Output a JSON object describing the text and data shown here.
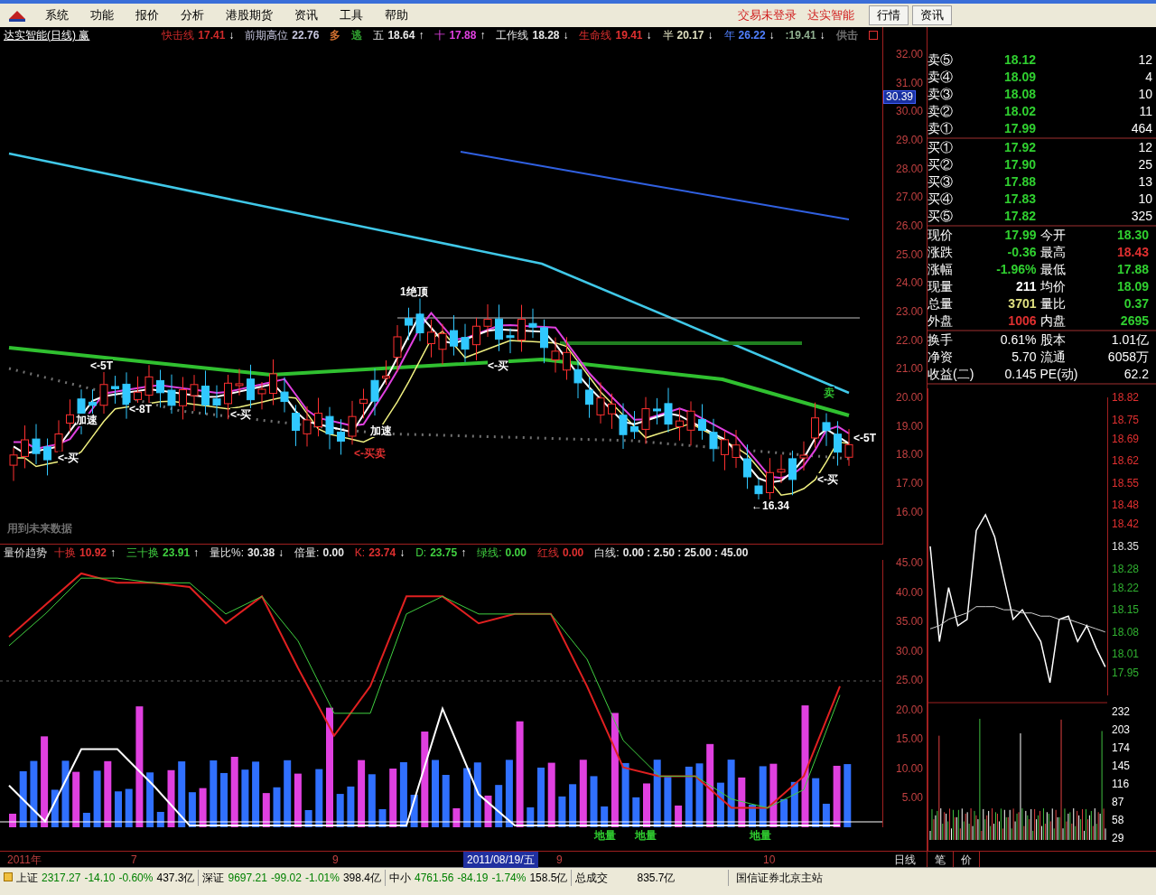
{
  "menu": {
    "items": [
      "系统",
      "功能",
      "报价",
      "分析",
      "港股期货",
      "资讯",
      "工具",
      "帮助"
    ],
    "status": [
      "交易未登录",
      "达实智能"
    ],
    "buttons": [
      "行情",
      "资讯"
    ]
  },
  "price_chart": {
    "title": "达实智能(日线) 赢",
    "indicators": [
      {
        "label": "快击线",
        "value": "17.41",
        "arrow": "↓",
        "color": "#d02a2a"
      },
      {
        "label": "前期高位",
        "value": "22.76",
        "color": "#c8c8e0"
      },
      {
        "label": "多",
        "color": "#d07030"
      },
      {
        "label": "逃",
        "color": "#30a030"
      },
      {
        "label": "五",
        "value": "18.64",
        "arrow": "↑",
        "color": "#e8e8e8"
      },
      {
        "label": "十",
        "value": "17.88",
        "arrow": "↑",
        "color": "#e040e0"
      },
      {
        "label": "工作线",
        "value": "18.28",
        "arrow": "↓",
        "color": "#e8e8e8"
      },
      {
        "label": "生命线",
        "value": "19.41",
        "arrow": "↓",
        "color": "#e03030"
      },
      {
        "label": "半",
        "value": "20.17",
        "arrow": "↓",
        "color": "#e0e0c0"
      },
      {
        "label": "年",
        "value": "26.22",
        "arrow": "↓",
        "color": "#5080ff"
      },
      {
        "value": ":19.41",
        "arrow": "↓",
        "color": "#90b090"
      },
      {
        "label": "供击",
        "color": "#707070"
      }
    ],
    "y_ticks": [
      "32.00",
      "31.00",
      "30.00",
      "29.00",
      "28.00",
      "27.00",
      "26.00",
      "25.00",
      "24.00",
      "23.00",
      "22.00",
      "21.00",
      "20.00",
      "19.00",
      "18.00",
      "17.00",
      "16.00"
    ],
    "current_marker": "30.39",
    "annotations": [
      {
        "text": "用到未来数据",
        "color": "#707070"
      },
      {
        "text": "1绝顶",
        "color": "#ffffff"
      },
      {
        "text": "<-5T",
        "color": "#ffffff"
      },
      {
        "text": "加速",
        "color": "#ffffff"
      },
      {
        "text": "<-8T",
        "color": "#ffffff"
      },
      {
        "text": "<-买",
        "color": "#ffffff"
      },
      {
        "text": "<-买",
        "color": "#ffffff"
      },
      {
        "text": "加速",
        "color": "#ffffff"
      },
      {
        "text": "<-买卖",
        "color": "#e03030"
      },
      {
        "text": "<-买",
        "color": "#ffffff"
      },
      {
        "text": "←16.34",
        "color": "#ffffff"
      },
      {
        "text": "卖",
        "color": "#30c030"
      },
      {
        "text": "<-5T",
        "color": "#ffffff"
      },
      {
        "text": "<-买",
        "color": "#ffffff"
      }
    ]
  },
  "volume_indicator": {
    "title": "量价趋势",
    "indicators": [
      {
        "label": "十换",
        "value": "10.92",
        "arrow": "↑",
        "color": "#e03030"
      },
      {
        "label": "三十换",
        "value": "23.91",
        "arrow": "↑",
        "color": "#40d040"
      },
      {
        "label": "量比%:",
        "value": "30.38",
        "arrow": "↓",
        "color": "#e8e8e8"
      },
      {
        "label": "倍量:",
        "value": "0.00",
        "color": "#e8e8e8"
      },
      {
        "label": "K:",
        "value": "23.74",
        "arrow": "↓",
        "color": "#e03030"
      },
      {
        "label": "D:",
        "value": "23.75",
        "arrow": "↑",
        "color": "#40d040"
      },
      {
        "label": "绿线:",
        "value": "0.00",
        "color": "#40d040"
      },
      {
        "label": "红线",
        "value": "0.00",
        "color": "#e03030"
      },
      {
        "label": "白线:",
        "value": "0.00 : 2.50 : 25.00 : 45.00",
        "color": "#e8e8e8"
      }
    ],
    "annotations": [
      {
        "text": "地量",
        "color": "#30d030"
      },
      {
        "text": "地量",
        "color": "#30d030"
      },
      {
        "text": "地量",
        "color": "#30d030"
      }
    ],
    "chart_data": {
      "type": "line",
      "ylim": [
        0,
        45.5
      ],
      "yticks": [
        {
          "value": 45,
          "label": "45.00"
        },
        {
          "value": 40,
          "label": "40.00"
        },
        {
          "value": 35,
          "label": "35.00"
        },
        {
          "value": 30,
          "label": "30.00"
        },
        {
          "value": 25,
          "label": "25.00"
        },
        {
          "value": 20,
          "label": "20.00"
        },
        {
          "value": 15,
          "label": "15.00"
        },
        {
          "value": 10,
          "label": "10.00"
        },
        {
          "value": 5,
          "label": "5.00"
        }
      ],
      "series": [
        {
          "color": "#e02020",
          "values": [
            32.4,
            37.8,
            43.2,
            41.6,
            41.6,
            40.9,
            34.7,
            39.3,
            27.1,
            15.6,
            24,
            39.3,
            39.3,
            34.7,
            36.3,
            36.3,
            24,
            10.2,
            8.7,
            8.7,
            3.3,
            3.3,
            8.7,
            24
          ]
        },
        {
          "color": "#40d040",
          "values": [
            30.9,
            36.3,
            42.4,
            42.4,
            41.6,
            41.6,
            36.3,
            39.3,
            31.7,
            19.4,
            19.4,
            36.3,
            39.3,
            36.3,
            36.3,
            36.3,
            28.6,
            14.8,
            8.7,
            8.7,
            4.8,
            3.3,
            6.4,
            22.5
          ]
        },
        {
          "color": "#ffffff",
          "values": [
            7.1,
            1,
            13.3,
            13.3,
            7.1,
            0.3,
            0.3,
            0.3,
            0.3,
            0.3,
            0.3,
            0.3,
            20.2,
            5.6,
            0.3,
            0.3,
            0.3,
            0.3,
            0.3,
            0.3,
            0.3,
            0.3,
            0.3,
            0.3
          ]
        }
      ]
    }
  },
  "time_axis": {
    "labels": [
      "2011年",
      "7",
      "9",
      "2011/08/19/五",
      "9",
      "10"
    ],
    "period": "日线"
  },
  "quote": {
    "sell": [
      {
        "label": "卖⑤",
        "price": "18.12",
        "volume": "12"
      },
      {
        "label": "卖④",
        "price": "18.09",
        "volume": "4"
      },
      {
        "label": "卖③",
        "price": "18.08",
        "volume": "10"
      },
      {
        "label": "卖②",
        "price": "18.02",
        "volume": "11"
      },
      {
        "label": "卖①",
        "price": "17.99",
        "volume": "464"
      }
    ],
    "buy": [
      {
        "label": "买①",
        "price": "17.92",
        "volume": "12"
      },
      {
        "label": "买②",
        "price": "17.90",
        "volume": "25"
      },
      {
        "label": "买③",
        "price": "17.88",
        "volume": "13"
      },
      {
        "label": "买④",
        "price": "17.83",
        "volume": "10"
      },
      {
        "label": "买⑤",
        "price": "17.82",
        "volume": "325"
      }
    ],
    "stats": [
      [
        {
          "label": "现价",
          "value": "17.99",
          "color": "#30d030"
        },
        {
          "label": "今开",
          "value": "18.30",
          "color": "#30d030"
        }
      ],
      [
        {
          "label": "涨跌",
          "value": "-0.36",
          "color": "#30d030"
        },
        {
          "label": "最高",
          "value": "18.43",
          "color": "#e03030"
        }
      ],
      [
        {
          "label": "涨幅",
          "value": "-1.96%",
          "color": "#30d030"
        },
        {
          "label": "最低",
          "value": "17.88",
          "color": "#30d030"
        }
      ],
      [
        {
          "label": "现量",
          "value": "211",
          "color": "#ffffff"
        },
        {
          "label": "均价",
          "value": "18.09",
          "color": "#30d030"
        }
      ],
      [
        {
          "label": "总量",
          "value": "3701",
          "color": "#e0e080"
        },
        {
          "label": "量比",
          "value": "0.37",
          "color": "#30d030"
        }
      ],
      [
        {
          "label": "外盘",
          "value": "1006",
          "color": "#e03030"
        },
        {
          "label": "内盘",
          "value": "2695",
          "color": "#30d030"
        }
      ]
    ],
    "fundamentals": [
      [
        {
          "label": "换手",
          "value": "0.61%"
        },
        {
          "label": "股本",
          "value": "1.01亿"
        }
      ],
      [
        {
          "label": "净资",
          "value": "5.70"
        },
        {
          "label": "流通",
          "value": "6058万"
        }
      ],
      [
        {
          "label": "收益(二)",
          "value": "0.145"
        },
        {
          "label": "PE(动)",
          "value": "62.2"
        }
      ]
    ]
  },
  "intraday": {
    "chart_data": {
      "type": "line",
      "ylim": [
        17.88,
        18.82
      ],
      "yticks": [
        {
          "value": 18.82,
          "label": "18.82"
        },
        {
          "value": 18.75,
          "label": "18.75"
        },
        {
          "value": 18.69,
          "label": "18.69"
        },
        {
          "value": 18.62,
          "label": "18.62"
        },
        {
          "value": 18.55,
          "label": "18.55"
        },
        {
          "value": 18.48,
          "label": "18.48"
        },
        {
          "value": 18.42,
          "label": "18.42"
        },
        {
          "value": 18.35,
          "label": "18.35"
        },
        {
          "value": 18.28,
          "label": "18.28"
        },
        {
          "value": 18.22,
          "label": "18.22"
        },
        {
          "value": 18.15,
          "label": "18.15"
        },
        {
          "value": 18.08,
          "label": "18.08"
        },
        {
          "value": 18.01,
          "label": "18.01"
        },
        {
          "value": 17.95,
          "label": "17.95"
        }
      ],
      "series": [
        {
          "color": "#ffffff",
          "values": [
            18.35,
            18.05,
            18.22,
            18.1,
            18.12,
            18.4,
            18.45,
            18.38,
            18.25,
            18.12,
            18.15,
            18.1,
            18.05,
            17.92,
            18.12,
            18.13,
            18.05,
            18.1,
            18.03,
            17.97
          ]
        },
        {
          "color": "#d0d0d0",
          "values": [
            18.09,
            18.1,
            18.12,
            18.13,
            18.14,
            18.16,
            18.16,
            18.16,
            18.15,
            18.15,
            18.14,
            18.14,
            18.13,
            18.13,
            18.12,
            18.12,
            18.11,
            18.1,
            18.09,
            18.08
          ]
        }
      ]
    },
    "volume_ticks": [
      "232",
      "203",
      "174",
      "145",
      "116",
      "87",
      "58",
      "29"
    ],
    "tabs": [
      "笔",
      "价"
    ]
  },
  "status_bar": {
    "indices": [
      {
        "name": "上证",
        "value": "2317.27",
        "change": "-14.10",
        "percent": "-0.60%",
        "amount": "437.3亿"
      },
      {
        "name": "深证",
        "value": "9697.21",
        "change": "-99.02",
        "percent": "-1.01%",
        "amount": "398.4亿"
      },
      {
        "name": "中小",
        "value": "4761.56",
        "change": "-84.19",
        "percent": "-1.74%",
        "amount": "158.5亿"
      }
    ],
    "total_label": "总成交",
    "total": "835.7亿",
    "server": "国信证券北京主站"
  }
}
